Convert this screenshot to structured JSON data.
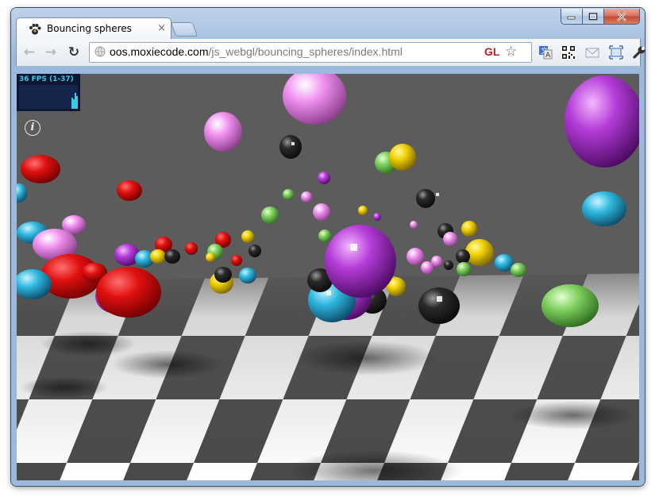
{
  "window": {
    "minimize_icon": "minimize-icon",
    "maximize_icon": "maximize-icon",
    "close_icon": "close-icon"
  },
  "tab": {
    "title": "Bouncing spheres",
    "close_glyph": "×",
    "favicon": "paw-icon"
  },
  "toolbar": {
    "back_glyph": "←",
    "forward_glyph": "→",
    "reload_glyph": "↻",
    "url_host": "oos.moxiecode.com",
    "url_path": "/js_webgl/bouncing_spheres/index.html",
    "gl_badge": "GL",
    "star_glyph": "☆",
    "extensions": [
      "translate-icon",
      "qr-code-icon",
      "mail-icon",
      "fullscreen-icon",
      "wrench-icon"
    ]
  },
  "scene": {
    "fps_text": "36 FPS (1-37)",
    "info_glyph": "i",
    "colors": {
      "background": "#5c5c5c",
      "floor_light": "#ffffff",
      "floor_dark": "#4a4a4a",
      "fps_text": "#38c8e8",
      "red": "#e01010",
      "magenta": "#c040e0",
      "pink": "#f090f0",
      "yellow": "#f0d000",
      "cyan": "#30b8e0",
      "green": "#80d060",
      "black": "#202020"
    }
  }
}
